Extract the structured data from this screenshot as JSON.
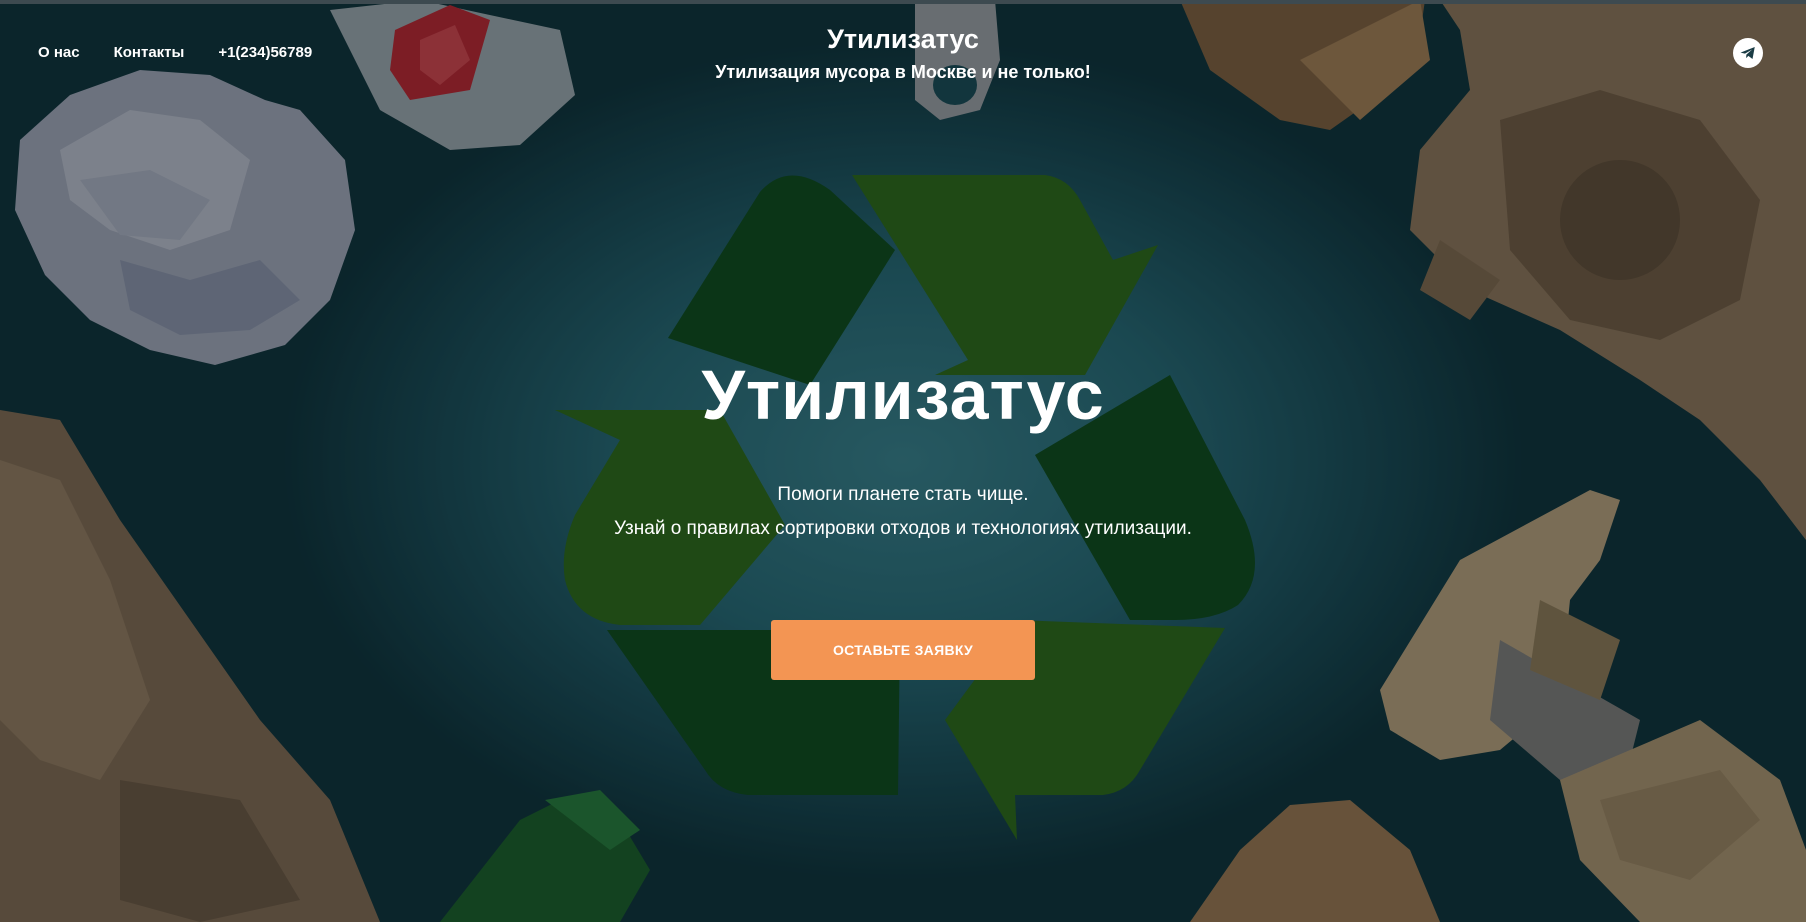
{
  "nav": {
    "items": [
      {
        "label": "О нас"
      },
      {
        "label": "Контакты"
      },
      {
        "label": "+1(234)56789"
      }
    ]
  },
  "brand": {
    "title": "Утилизатус",
    "subtitle": "Утилизация мусора в Москве и не только!"
  },
  "hero": {
    "title": "Утилизатус",
    "line1": "Помоги планете стать чище.",
    "line2": "Узнай о правилах сортировки отходов и технологиях утилизации.",
    "cta_label": "ОСТАВЬТЕ ЗАЯВКУ"
  },
  "social": {
    "icon": "telegram-icon"
  },
  "colors": {
    "accent": "#f39553",
    "recycle_dark": "#0b3517",
    "recycle_mid": "#1f4915"
  }
}
